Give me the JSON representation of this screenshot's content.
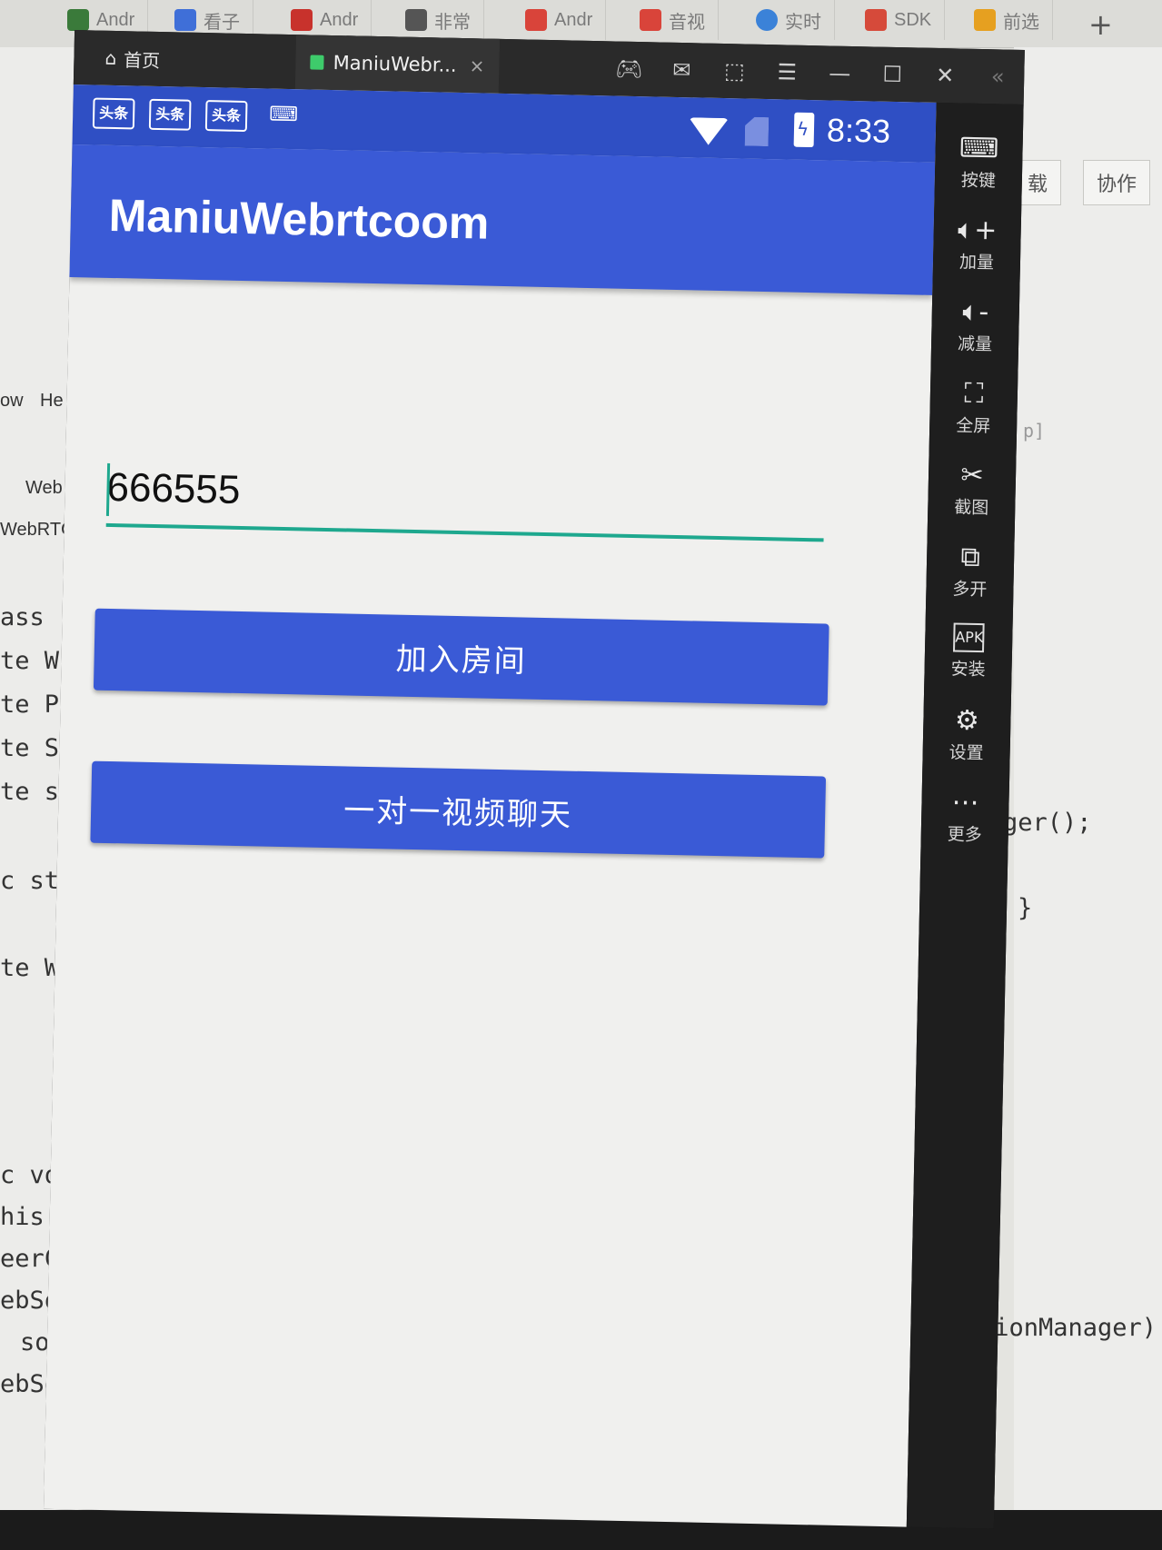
{
  "browser_tabs": [
    {
      "label": "Andr",
      "color": "#3a7a3a"
    },
    {
      "label": "看子",
      "color": "#3f6fd8"
    },
    {
      "label": "Andr",
      "color": "#c8322c"
    },
    {
      "label": "非常",
      "color": "#555555"
    },
    {
      "label": "Andr",
      "color": "#d9443a"
    },
    {
      "label": "音视",
      "color": "#d9443a"
    },
    {
      "label": "实时",
      "color": "#3b82d8"
    },
    {
      "label": "SDK",
      "color": "#d64a3a"
    },
    {
      "label": "前选",
      "color": "#e6a020"
    }
  ],
  "browser_add_tab": "+",
  "ide_left": {
    "menu": [
      "ow",
      "He"
    ],
    "file_tab": "Web",
    "breadcrumb": "WebRTC",
    "code_lines": [
      "ass",
      "te W",
      "te P",
      "te S",
      "te s",
      "c st",
      "te W",
      "c vo",
      "his.",
      "eerC",
      "ebSo",
      "soc",
      "ebSo"
    ]
  },
  "ide_right": {
    "buttons": [
      "载",
      "协作"
    ],
    "hint": "p]",
    "code_lines": [
      "ger();",
      "}",
      "tionManager)"
    ]
  },
  "emulator": {
    "home_tab": "首页",
    "app_tab": "ManiuWebr...",
    "close_tab": "×",
    "side_tools": [
      {
        "label": "按键",
        "icon": "keyboard-icon"
      },
      {
        "label": "加量",
        "icon": "volume-up-icon"
      },
      {
        "label": "减量",
        "icon": "volume-down-icon"
      },
      {
        "label": "全屏",
        "icon": "fullscreen-icon"
      },
      {
        "label": "截图",
        "icon": "scissors-icon"
      },
      {
        "label": "多开",
        "icon": "multi-window-icon"
      },
      {
        "label": "安装",
        "icon": "apk-icon"
      },
      {
        "label": "设置",
        "icon": "gear-icon"
      },
      {
        "label": "更多",
        "icon": "more-icon"
      }
    ]
  },
  "phone": {
    "status_bar": {
      "notifications": [
        "头条",
        "头条",
        "头条"
      ],
      "time": "8:33",
      "accent": "#2f4fc4"
    },
    "app_bar": {
      "title": "ManiuWebrtcoom",
      "color": "#3a5ad6"
    },
    "room_input": {
      "value": "666555",
      "underline_color": "#1ea88e"
    },
    "join_button": "加入房间",
    "chat_button": "一对一视频聊天"
  }
}
